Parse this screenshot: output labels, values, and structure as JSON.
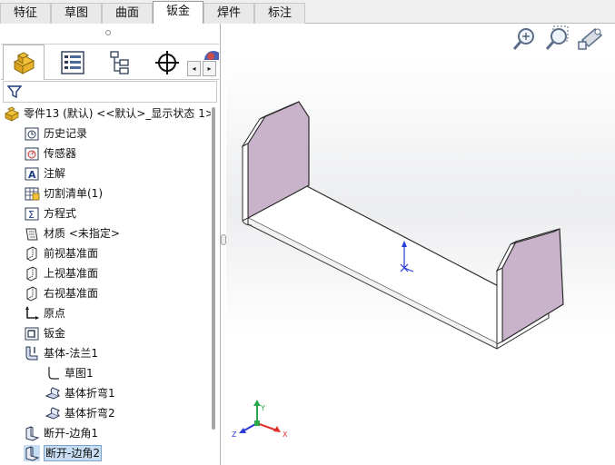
{
  "tabs": [
    {
      "label": "特征",
      "active": false
    },
    {
      "label": "草图",
      "active": false
    },
    {
      "label": "曲面",
      "active": false
    },
    {
      "label": "钣金",
      "active": true
    },
    {
      "label": "焊件",
      "active": false
    },
    {
      "label": "标注",
      "active": false
    }
  ],
  "panel_tabs": [
    {
      "icon": "feature-manager-icon",
      "active": true
    },
    {
      "icon": "property-manager-icon",
      "active": false
    },
    {
      "icon": "configuration-manager-icon",
      "active": false
    },
    {
      "icon": "dimxpert-manager-icon",
      "active": false
    }
  ],
  "panel_scroll": {
    "left": "◂",
    "right": "▸"
  },
  "tree": [
    {
      "label": "零件13 (默认) <<默认>_显示状态 1>",
      "icon": "part-icon",
      "indent": 0,
      "expander": ""
    },
    {
      "label": "历史记录",
      "icon": "history-icon",
      "indent": 1,
      "expander": "▸"
    },
    {
      "label": "传感器",
      "icon": "sensor-icon",
      "indent": 1,
      "expander": ""
    },
    {
      "label": "注解",
      "icon": "annotation-icon",
      "indent": 1,
      "expander": "▸"
    },
    {
      "label": "切割清单(1)",
      "icon": "cut-list-icon",
      "indent": 1,
      "expander": "▸"
    },
    {
      "label": "方程式",
      "icon": "equation-icon",
      "indent": 1,
      "expander": "▸"
    },
    {
      "label": "材质 <未指定>",
      "icon": "material-icon",
      "indent": 1,
      "expander": ""
    },
    {
      "label": "前视基准面",
      "icon": "plane-icon",
      "indent": 1,
      "expander": ""
    },
    {
      "label": "上视基准面",
      "icon": "plane-icon",
      "indent": 1,
      "expander": ""
    },
    {
      "label": "右视基准面",
      "icon": "plane-icon",
      "indent": 1,
      "expander": ""
    },
    {
      "label": "原点",
      "icon": "origin-icon",
      "indent": 1,
      "expander": ""
    },
    {
      "label": "钣金",
      "icon": "sheet-metal-icon",
      "indent": 1,
      "expander": "▸"
    },
    {
      "label": "基体-法兰1",
      "icon": "base-flange-icon",
      "indent": 1,
      "expander": "▾"
    },
    {
      "label": "草图1",
      "icon": "sketch-icon",
      "indent": 2,
      "expander": ""
    },
    {
      "label": "基体折弯1",
      "icon": "bend-icon",
      "indent": 2,
      "expander": ""
    },
    {
      "label": "基体折弯2",
      "icon": "bend-icon",
      "indent": 2,
      "expander": ""
    },
    {
      "label": "断开-边角1",
      "icon": "break-corner-icon",
      "indent": 1,
      "expander": ""
    },
    {
      "label": "断开-边角2",
      "icon": "break-corner-icon",
      "indent": 1,
      "expander": "",
      "selected": true
    }
  ],
  "triad": {
    "x": "X",
    "y": "Y",
    "z": "Z"
  },
  "colors": {
    "face_fill": "#c9b3cb",
    "face_white": "#ffffff",
    "edge": "#2b2b2b",
    "axis_x": "#e0302c",
    "axis_y": "#2aa84a",
    "axis_z": "#2a3bd6",
    "selection": "#c7ddf3"
  }
}
